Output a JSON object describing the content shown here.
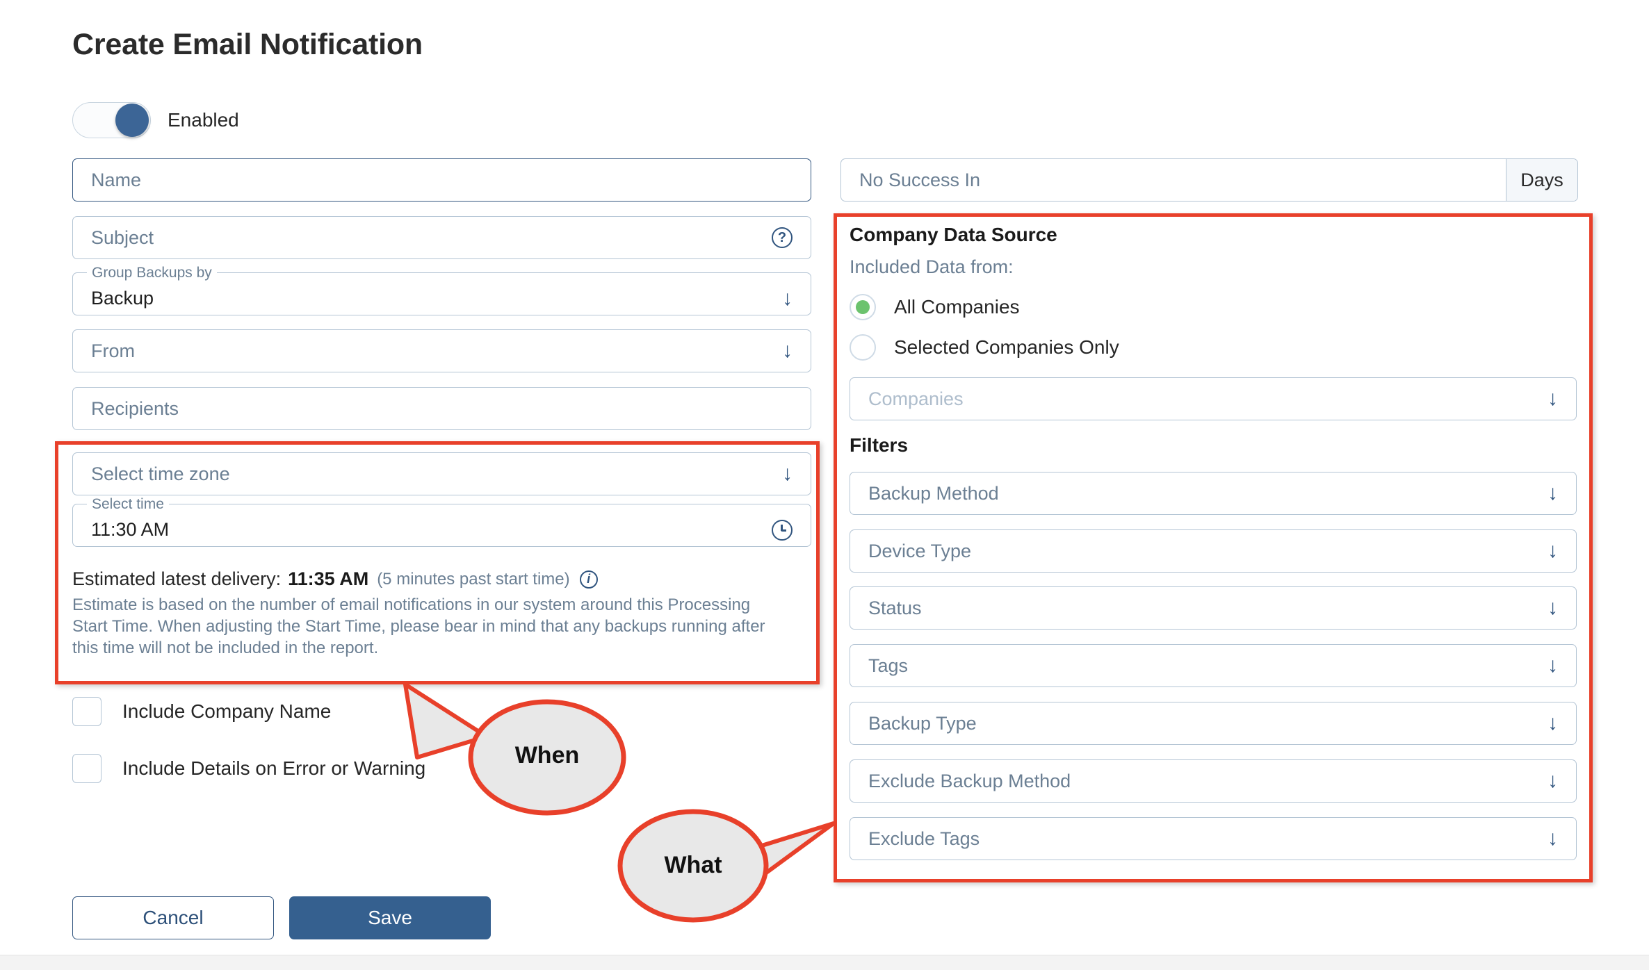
{
  "page": {
    "title": "Create Email Notification"
  },
  "enabled_toggle": {
    "label": "Enabled",
    "state": "on"
  },
  "left_form": {
    "name": {
      "placeholder": "Name",
      "value": ""
    },
    "subject": {
      "placeholder": "Subject",
      "value": "",
      "help_icon": "question-mark-circle-icon"
    },
    "group_backups_by": {
      "legend": "Group Backups by",
      "value": "Backup",
      "icon": "chevron-down-icon"
    },
    "from": {
      "placeholder": "From",
      "value": "",
      "icon": "chevron-down-icon"
    },
    "recipients": {
      "placeholder": "Recipients",
      "value": ""
    },
    "time_zone": {
      "placeholder": "Select time zone",
      "value": "",
      "icon": "chevron-down-icon"
    },
    "select_time": {
      "legend": "Select time",
      "value": "11:30 AM",
      "icon": "clock-icon"
    },
    "estimate": {
      "prefix": "Estimated latest delivery:",
      "time": "11:35 AM",
      "suffix": "(5 minutes past start time)",
      "info_icon": "info-circle-icon",
      "note": "Estimate is based on the number of email notifications in our system around this Processing Start Time. When adjusting the Start Time, please bear in mind that any backups running after this time will not be included in the report."
    },
    "checkboxes": [
      {
        "label": "Include Company Name",
        "checked": false
      },
      {
        "label": "Include Details on Error or Warning",
        "checked": false
      }
    ],
    "buttons": {
      "cancel": "Cancel",
      "save": "Save"
    }
  },
  "right_form": {
    "no_success_in": {
      "placeholder": "No Success In",
      "value": "",
      "suffix": "Days"
    },
    "company_data_source": {
      "title": "Company Data Source",
      "subtitle": "Included Data from:",
      "options": [
        {
          "label": "All Companies",
          "selected": true
        },
        {
          "label": "Selected Companies Only",
          "selected": false
        }
      ],
      "companies_select": {
        "placeholder": "Companies",
        "value": "",
        "icon": "chevron-down-icon",
        "disabled": true
      }
    },
    "filters": {
      "title": "Filters",
      "items": [
        {
          "placeholder": "Backup Method",
          "icon": "chevron-down-icon"
        },
        {
          "placeholder": "Device Type",
          "icon": "chevron-down-icon"
        },
        {
          "placeholder": "Status",
          "icon": "chevron-down-icon"
        },
        {
          "placeholder": "Tags",
          "icon": "chevron-down-icon"
        },
        {
          "placeholder": "Backup Type",
          "icon": "chevron-down-icon"
        },
        {
          "placeholder": "Exclude Backup Method",
          "icon": "chevron-down-icon"
        },
        {
          "placeholder": "Exclude Tags",
          "icon": "chevron-down-icon"
        }
      ]
    }
  },
  "annotations": {
    "when": "When",
    "what": "What",
    "highlight_color": "#e8402a"
  }
}
